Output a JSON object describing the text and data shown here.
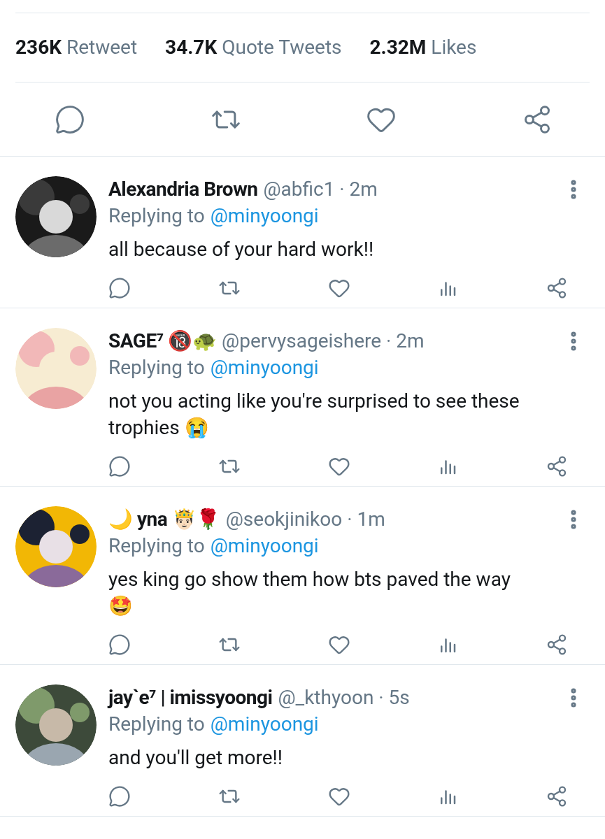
{
  "stats": [
    "**236K** Retweet",
    "**34.7K** Quote Tweets",
    "**2.32M** Likes"
  ],
  "replies": [
    {
      "name": "Alexandria Brown",
      "meta": "@abfic1 · 2m",
      "replying_prefix": "Replying to",
      "replying_to": "@minyoongi",
      "text": "all because of your hard work!!"
    },
    {
      "name": "SAGE⁷ 🔞🐢",
      "meta": "@pervysageishere · 2m",
      "replying_prefix": "Replying to",
      "replying_to": "@minyoongi",
      "text": "not you acting like you're surprised to see these trophies 😭"
    },
    {
      "name": "🌙 yna 🤴🏻🌹",
      "meta": "@seokjinikoo · 1m",
      "replying_prefix": "Replying to",
      "replying_to": "@minyoongi",
      "text": "yes king go show them how bts paved the way 🤩"
    },
    {
      "name": "jay`e⁷ | imissyoongi",
      "meta": "@_kthyoon · 5s",
      "replying_prefix": "Replying to",
      "replying_to": "@minyoongi",
      "text": "and you'll get more!!"
    }
  ]
}
